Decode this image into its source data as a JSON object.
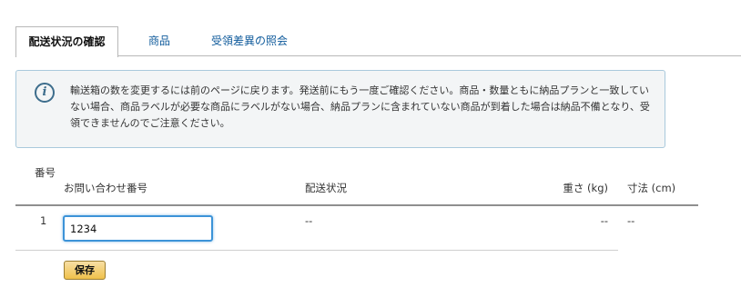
{
  "tabs": {
    "confirm_shipping": "配送状況の確認",
    "products": "商品",
    "discrepancy": "受領差異の照会"
  },
  "info": {
    "icon": "info-icon",
    "message": "輸送箱の数を変更するには前のページに戻ります。発送前にもう一度ご確認ください。商品・数量ともに納品プランと一致していない場合、商品ラベルが必要な商品にラベルがない場合、納品プランに含まれていない商品が到着した場合は納品不備となり、受領できませんのでご注意ください。"
  },
  "table": {
    "headers": {
      "number": "番号",
      "tracking": "お問い合わせ番号",
      "status": "配送状況",
      "weight": "重さ (kg)",
      "dimensions": "寸法 (cm)"
    },
    "rows": [
      {
        "number": "1",
        "tracking_value": "1234",
        "status": "--",
        "weight": "--",
        "dimensions": "--"
      }
    ]
  },
  "actions": {
    "save_label": "保存"
  },
  "colors": {
    "tab_link": "#0e5a9b",
    "info_border": "#a9c9dc",
    "info_background": "#f3f5f6",
    "input_focus": "#3c93d8",
    "button": "#f0c14b"
  }
}
